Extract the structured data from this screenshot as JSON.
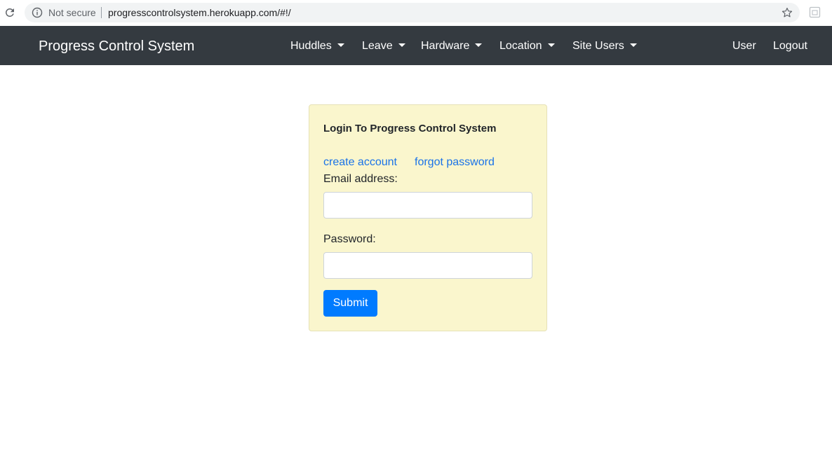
{
  "browser": {
    "security_label": "Not secure",
    "url": "progresscontrolsystem.herokuapp.com/#!/"
  },
  "navbar": {
    "brand": "Progress Control System",
    "menus": [
      {
        "label": "Huddles"
      },
      {
        "label": "Leave"
      },
      {
        "label": "Hardware"
      },
      {
        "label": "Location"
      },
      {
        "label": "Site Users"
      }
    ],
    "user_label": "User",
    "logout_label": "Logout"
  },
  "login": {
    "title": "Login To Progress Control System",
    "create_account": "create account",
    "forgot_password": "forgot password",
    "email_label": "Email address:",
    "email_value": "",
    "password_label": "Password:",
    "password_value": "",
    "submit_label": "Submit"
  },
  "colors": {
    "navbar_bg": "#343a40",
    "card_bg": "#faf6cd",
    "link": "#1a73e8",
    "primary": "#007bff"
  }
}
